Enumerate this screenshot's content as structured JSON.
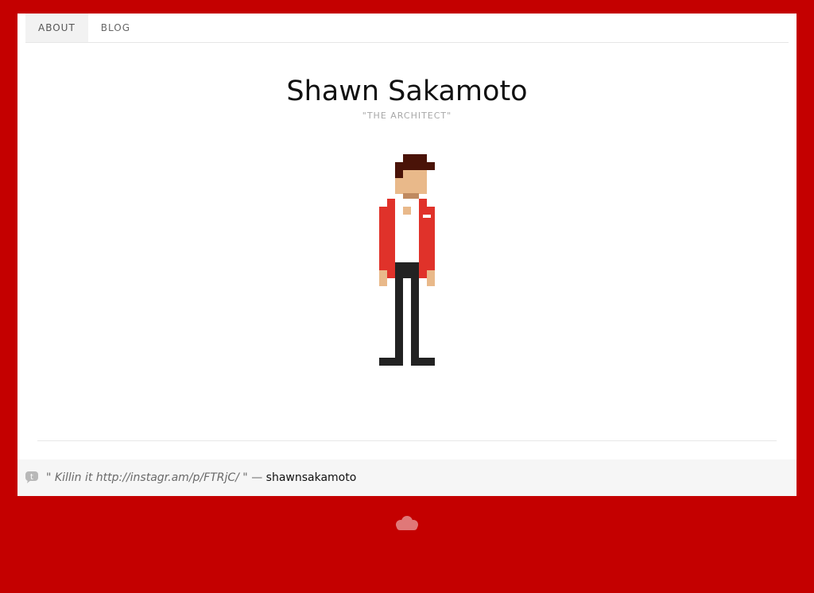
{
  "nav": {
    "items": [
      {
        "label": "ABOUT",
        "active": true
      },
      {
        "label": "BLOG",
        "active": false
      }
    ]
  },
  "header": {
    "title": "Shawn Sakamoto",
    "subtitle": "\"THE ARCHITECT\""
  },
  "avatar": {
    "icon": "pixel-person-icon"
  },
  "tweet": {
    "icon": "twitter-bird-icon",
    "text": "\" Killin it http://instagr.am/p/FTRjC/ \"",
    "dash": "—",
    "author": "shawnsakamoto"
  },
  "footer": {
    "icon": "cloud-icon"
  },
  "colors": {
    "background": "#c40000",
    "card": "#ffffff",
    "jacket": "#e0322a",
    "skin": "#e9b98a",
    "hair": "#4a1308",
    "pants": "#222222"
  }
}
